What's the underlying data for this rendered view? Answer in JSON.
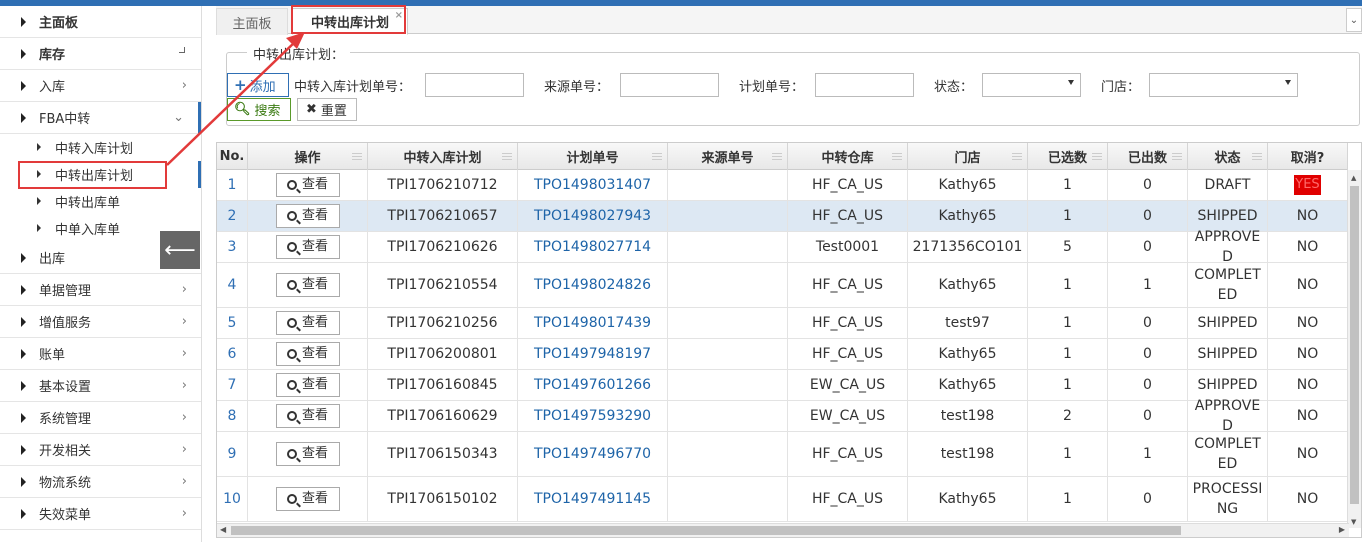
{
  "sidebar": {
    "items": [
      {
        "label": "主面板",
        "chev": ""
      },
      {
        "label": "库存",
        "chev": ""
      },
      {
        "label": "入库",
        "chev": "›"
      },
      {
        "label": "FBA中转",
        "chev": "⌄"
      },
      {
        "label": "出库",
        "chev": ""
      },
      {
        "label": "单据管理",
        "chev": "›"
      },
      {
        "label": "增值服务",
        "chev": "›"
      },
      {
        "label": "账单",
        "chev": "›"
      },
      {
        "label": "基本设置",
        "chev": "›"
      },
      {
        "label": "系统管理",
        "chev": "›"
      },
      {
        "label": "开发相关",
        "chev": "›"
      },
      {
        "label": "物流系统",
        "chev": "›"
      },
      {
        "label": "失效菜单",
        "chev": "›"
      }
    ],
    "sub_items": [
      {
        "label": "中转入库计划"
      },
      {
        "label": "中转出库计划"
      },
      {
        "label": "中转出库单"
      },
      {
        "label": "中单入库单"
      }
    ],
    "collapse_glyph": "⟵"
  },
  "tabs": [
    {
      "label": "主面板"
    },
    {
      "label": "中转出库计划",
      "close": "×"
    }
  ],
  "tab_dropdown": "⌄",
  "filter": {
    "legend": "中转出库计划：",
    "add_label": "添加",
    "fields": [
      {
        "label": "中转入库计划单号：",
        "value": ""
      },
      {
        "label": "来源单号：",
        "value": ""
      },
      {
        "label": "计划单号：",
        "value": ""
      },
      {
        "label": "状态：",
        "value": ""
      },
      {
        "label": "门店：",
        "value": ""
      }
    ],
    "search_label": "搜索",
    "reset_label": "重置"
  },
  "grid": {
    "headers": [
      "No.",
      "操作",
      "中转入库计划",
      "计划单号",
      "来源单号",
      "中转仓库",
      "门店",
      "已选数",
      "已出数",
      "状态",
      "取消?"
    ],
    "view_label": "查看",
    "rows": [
      {
        "no": "1",
        "plan": "TPI1706210712",
        "order": "TPO1498031407",
        "source": "",
        "warehouse": "HF_CA_US",
        "store": "Kathy65",
        "selected": "1",
        "shipped": "0",
        "status": "DRAFT",
        "cancel": "YES"
      },
      {
        "no": "2",
        "plan": "TPI1706210657",
        "order": "TPO1498027943",
        "source": "",
        "warehouse": "HF_CA_US",
        "store": "Kathy65",
        "selected": "1",
        "shipped": "0",
        "status": "SHIPPED",
        "cancel": "NO"
      },
      {
        "no": "3",
        "plan": "TPI1706210626",
        "order": "TPO1498027714",
        "source": "",
        "warehouse": "Test0001",
        "store": "2171356CO101",
        "selected": "5",
        "shipped": "0",
        "status": "APPROVED",
        "cancel": "NO"
      },
      {
        "no": "4",
        "plan": "TPI1706210554",
        "order": "TPO1498024826",
        "source": "",
        "warehouse": "HF_CA_US",
        "store": "Kathy65",
        "selected": "1",
        "shipped": "1",
        "status": "COMPLETED",
        "cancel": "NO"
      },
      {
        "no": "5",
        "plan": "TPI1706210256",
        "order": "TPO1498017439",
        "source": "",
        "warehouse": "HF_CA_US",
        "store": "test97",
        "selected": "1",
        "shipped": "0",
        "status": "SHIPPED",
        "cancel": "NO"
      },
      {
        "no": "6",
        "plan": "TPI1706200801",
        "order": "TPO1497948197",
        "source": "",
        "warehouse": "HF_CA_US",
        "store": "Kathy65",
        "selected": "1",
        "shipped": "0",
        "status": "SHIPPED",
        "cancel": "NO"
      },
      {
        "no": "7",
        "plan": "TPI1706160845",
        "order": "TPO1497601266",
        "source": "",
        "warehouse": "EW_CA_US",
        "store": "Kathy65",
        "selected": "1",
        "shipped": "0",
        "status": "SHIPPED",
        "cancel": "NO"
      },
      {
        "no": "8",
        "plan": "TPI1706160629",
        "order": "TPO1497593290",
        "source": "",
        "warehouse": "EW_CA_US",
        "store": "test198",
        "selected": "2",
        "shipped": "0",
        "status": "APPROVED",
        "cancel": "NO"
      },
      {
        "no": "9",
        "plan": "TPI1706150343",
        "order": "TPO1497496770",
        "source": "",
        "warehouse": "HF_CA_US",
        "store": "test198",
        "selected": "1",
        "shipped": "1",
        "status": "COMPLETED",
        "cancel": "NO"
      },
      {
        "no": "10",
        "plan": "TPI1706150102",
        "order": "TPO1497491145",
        "source": "",
        "warehouse": "HF_CA_US",
        "store": "Kathy65",
        "selected": "1",
        "shipped": "0",
        "status": "PROCESSING",
        "cancel": "NO"
      }
    ]
  },
  "colors": {
    "accent": "#2f6fb4",
    "annotation": "#e23a3a",
    "selected_row": "#dde8f3",
    "cancel_yes_bg": "#e00000"
  }
}
